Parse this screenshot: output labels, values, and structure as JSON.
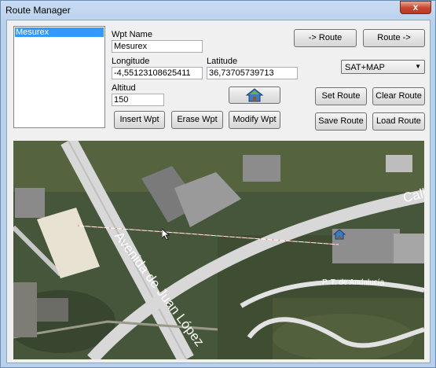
{
  "window": {
    "title": "Route Manager",
    "close_glyph": "x"
  },
  "waypoint_list": {
    "items": [
      "Mesurex"
    ]
  },
  "form": {
    "wpt_name_label": "Wpt Name",
    "wpt_name_value": "Mesurex",
    "longitude_label": "Longitude",
    "longitude_value": "-4,55123108625411",
    "latitude_label": "Latitude",
    "latitude_value": "36,73705739713",
    "altitude_label": "Altitud",
    "altitude_value": "150"
  },
  "buttons": {
    "to_route": "-> Route",
    "route_to": "Route ->",
    "insert_wpt": "Insert Wpt",
    "erase_wpt": "Erase Wpt",
    "modify_wpt": "Modify Wpt",
    "set_route": "Set Route",
    "clear_route": "Clear Route",
    "save_route": "Save Route",
    "load_route": "Load Route",
    "home_icon": "home-icon"
  },
  "map_type": {
    "selected": "SAT+MAP",
    "arrow_icon": "chevron-down-icon"
  },
  "map": {
    "labels": {
      "avenue": "Avenida de Juan López",
      "park": "P. T. de Andalucía",
      "calle": "Calle"
    },
    "colors": {
      "satellite": "#3b4a2c",
      "road": "#d8d8d8"
    },
    "marker_icon": "house-marker-icon"
  }
}
